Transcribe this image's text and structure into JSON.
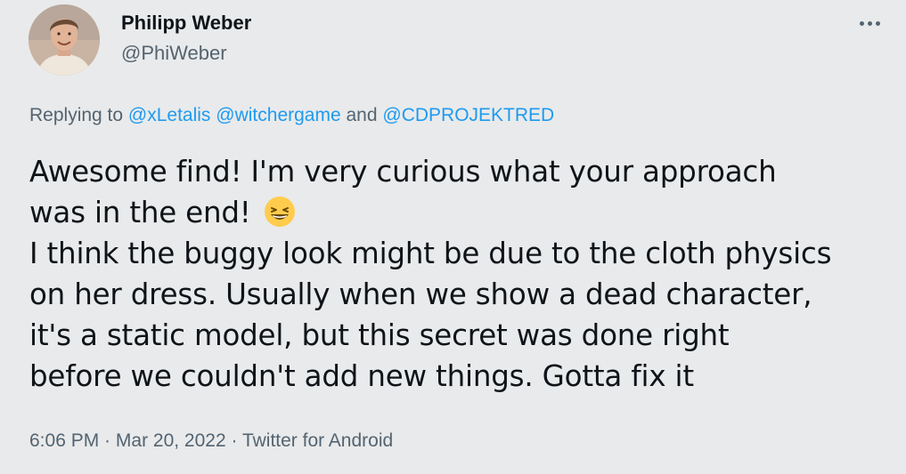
{
  "author": {
    "display_name": "Philipp Weber",
    "handle": "@PhiWeber"
  },
  "reply": {
    "prefix": "Replying to ",
    "mentions": [
      "@xLetalis",
      "@witchergame",
      "@CDPROJEKTRED"
    ],
    "joiner": " and "
  },
  "tweet": {
    "lines": [
      "Awesome find! I'm very curious what your approach",
      "was in the end! ",
      "I think the buggy look might be due to the cloth physics",
      "on her dress. Usually when we show a dead character,",
      "it's a static model, but this secret was done right",
      "before we couldn't add new things. Gotta fix it"
    ],
    "emoji": "grinning-squinting-face-emoji"
  },
  "meta": {
    "time": "6:06 PM",
    "separator": " · ",
    "date": "Mar 20, 2022",
    "source": "Twitter for Android"
  },
  "icons": {
    "more": "more-options-icon"
  },
  "colors": {
    "background": "#e9eaeb",
    "text": "#0f1419",
    "secondary": "#536471",
    "link": "#1d9bf0"
  }
}
